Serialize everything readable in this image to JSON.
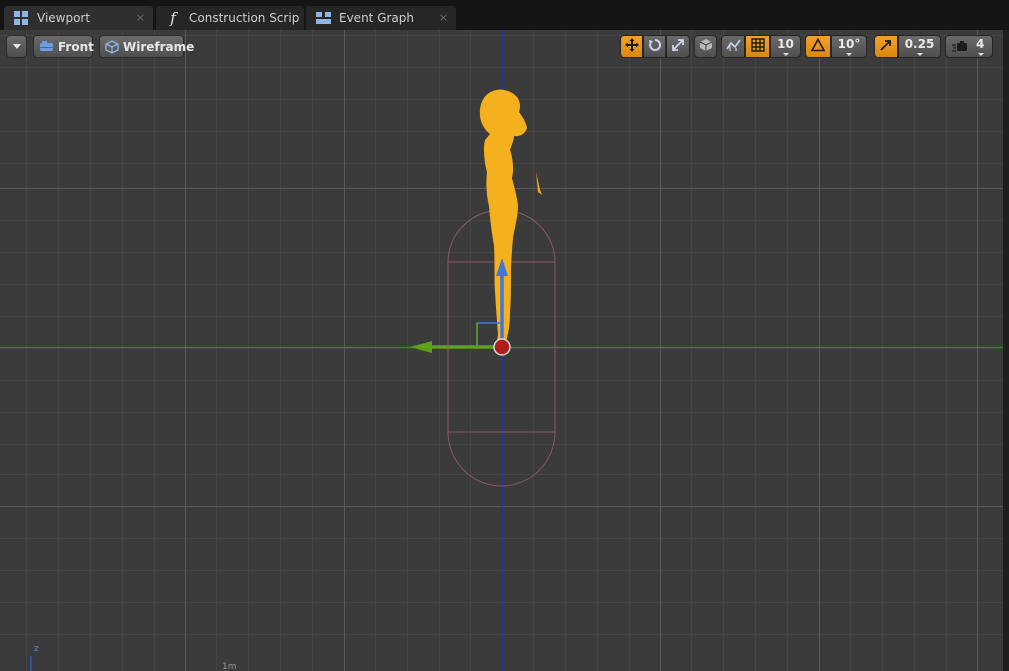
{
  "tabs": [
    {
      "label": "Viewport",
      "icon": "viewport-grid-icon",
      "active": true,
      "close": "×"
    },
    {
      "label": "Construction Scrip",
      "icon": "function-icon",
      "active": false,
      "glyph": "f"
    },
    {
      "label": "Event Graph",
      "icon": "graph-icon",
      "active": false,
      "close": "×"
    }
  ],
  "toolbar": {
    "view_mode": "Front",
    "render_mode": "Wireframe",
    "grid_snap_value": "10",
    "rotation_snap_value": "10°",
    "scale_snap_value": "0.25",
    "camera_speed_value": "4"
  },
  "axis_indicator": {
    "z_label": "z"
  },
  "scale_label": "1m",
  "colors": {
    "accent_orange": "#f0a020",
    "viewport_bg": "#3b3b3b",
    "mesh_selected": "#f5b01d",
    "capsule": "#8a5a5f",
    "axis_green": "#2f8a1e",
    "axis_blue": "#2030c0",
    "gizmo_blue": "#3f78d8",
    "gizmo_green": "#5fa01a",
    "gizmo_red": "#c0201c"
  }
}
